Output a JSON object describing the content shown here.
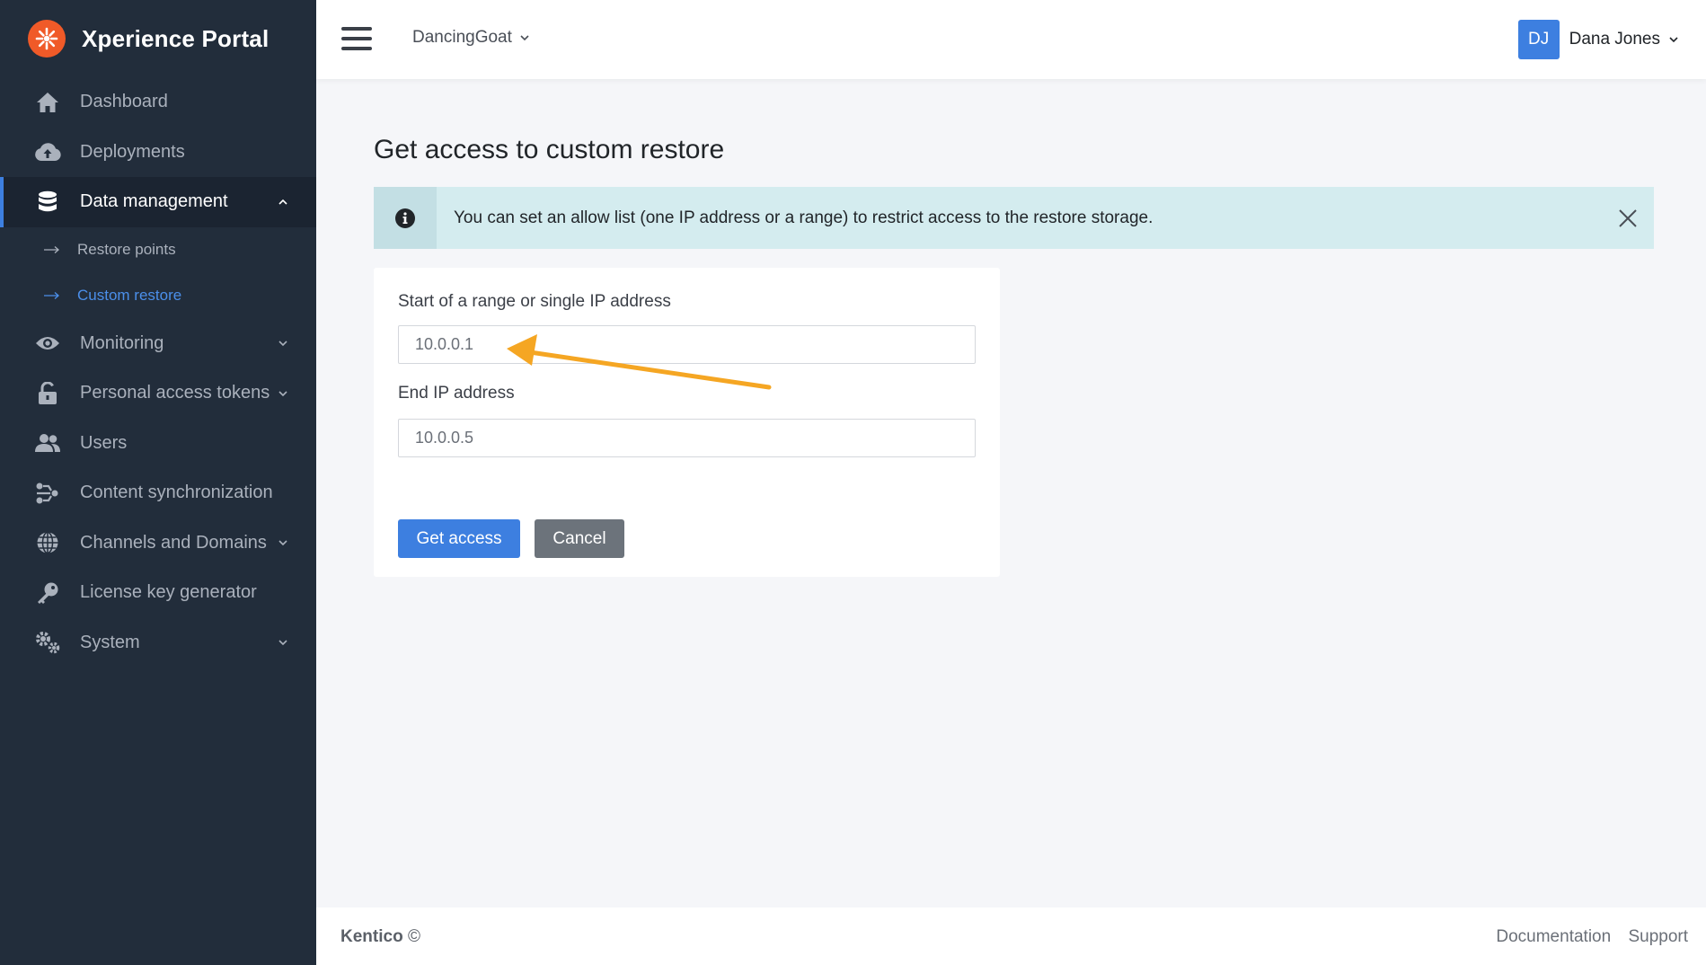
{
  "app": {
    "title": "Xperience Portal",
    "logo": "kentico-flower-logo"
  },
  "sidebar": {
    "items": [
      {
        "label": "Dashboard",
        "icon": "home-icon"
      },
      {
        "label": "Deployments",
        "icon": "cloud-upload-icon"
      },
      {
        "label": "Data management",
        "icon": "database-icon",
        "expanded": true,
        "children": [
          {
            "label": "Restore points"
          },
          {
            "label": "Custom restore",
            "current": true
          }
        ]
      },
      {
        "label": "Monitoring",
        "icon": "eye-icon"
      },
      {
        "label": "Personal access tokens",
        "icon": "lock-icon"
      },
      {
        "label": "Users",
        "icon": "users-icon"
      },
      {
        "label": "Content synchronization",
        "icon": "sync-icon"
      },
      {
        "label": "Channels and Domains",
        "icon": "globe-icon"
      },
      {
        "label": "License key generator",
        "icon": "key-icon"
      },
      {
        "label": "System",
        "icon": "gears-icon"
      }
    ]
  },
  "header": {
    "project": "DancingGoat",
    "user": {
      "initials": "DJ",
      "name": "Dana Jones"
    }
  },
  "main": {
    "title": "Get access to custom restore",
    "alert": {
      "text": "You can set an allow list (one IP address or a range) to restrict access to the restore storage.",
      "icon": "info-icon"
    },
    "form": {
      "start_label": "Start of a range or single IP address",
      "start_value": "10.0.0.1",
      "end_label": "End IP address",
      "end_value": "10.0.0.5",
      "submit_label": "Get access",
      "cancel_label": "Cancel"
    }
  },
  "footer": {
    "brand": "Kentico",
    "copyright": "©",
    "links": [
      "Documentation",
      "Support"
    ]
  },
  "colors": {
    "sidebar_bg": "#222d3b",
    "accent": "#3d7fe0",
    "alert_bg": "#d4ecef",
    "annotation": "#f5a623",
    "brand": "#f05a28"
  }
}
